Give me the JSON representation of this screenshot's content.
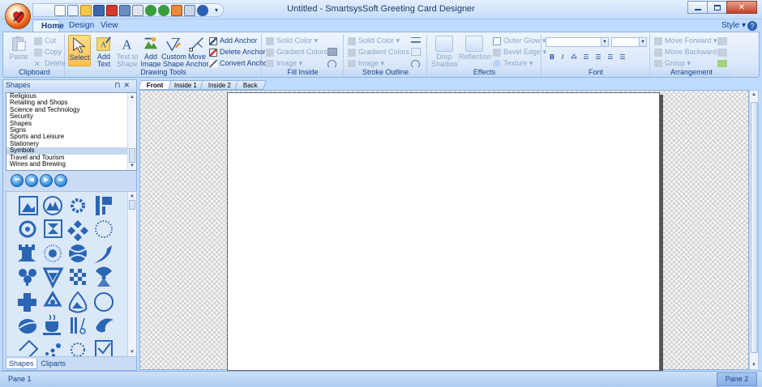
{
  "window": {
    "title": "Untitled - SmartsysSoft Greeting Card Designer"
  },
  "ribbon": {
    "tabs": [
      {
        "label": "Home",
        "active": true
      },
      {
        "label": "Design",
        "active": false
      },
      {
        "label": "View",
        "active": false
      }
    ],
    "style_menu": "Style",
    "clipboard": {
      "label": "Clipboard",
      "paste": "Paste",
      "cut": "Cut",
      "copy": "Copy",
      "delete": "Delete"
    },
    "drawing_tools": {
      "label": "Drawing Tools",
      "select": "Select",
      "add_text": "Add Text",
      "text_to_shape": "Text to Shape",
      "add_image": "Add Image",
      "custom_shape": "Custom Shape",
      "move_anchor": "Move Anchor",
      "add_anchor": "Add Anchor",
      "delete_anchor": "Delete Anchor",
      "convert_anchor": "Convert Anchor"
    },
    "fill_inside": {
      "label": "Fill Inside",
      "solid_color": "Solid Color",
      "gradient_colors": "Gradient Colors",
      "image": "Image"
    },
    "stroke_outline": {
      "label": "Stroke Outline",
      "solid_color": "Solid Color",
      "gradient_colors": "Gradient Colors",
      "image": "Image"
    },
    "effects": {
      "label": "Effects",
      "drop_shadow": "Drop Shadow",
      "reflection": "Reflection",
      "outer_glow": "Outer Glow",
      "bevel_edge": "Bevel Edge",
      "texture": "Texture"
    },
    "font": {
      "label": "Font",
      "bold": "B",
      "italic": "I"
    },
    "arrangement": {
      "label": "Arrangement",
      "move_forward": "Move Forward",
      "move_backward": "Move Backward",
      "group": "Group"
    }
  },
  "shapes_pane": {
    "title": "Shapes",
    "categories": [
      "Religious",
      "Retailing and Shops",
      "Science and Technology",
      "Security",
      "Shapes",
      "Signs",
      "Sports and Leisure",
      "Stationery",
      "Symbols",
      "Travel and Tourism",
      "Wines and Brewing"
    ],
    "selected_category": "Symbols",
    "tabs": [
      "Shapes",
      "Cliparts"
    ]
  },
  "document": {
    "page_tabs": [
      "Front",
      "Inside 1",
      "Inside 2",
      "Back"
    ],
    "active_page": "Front"
  },
  "status": {
    "left": "Pane 1",
    "right": "Pane 2"
  },
  "colors": {
    "ribbon_bg": "#dbe8f9",
    "accent_blue": "#15428b",
    "shape_blue": "#2b66b5",
    "select_highlight": "#ffc04a"
  }
}
